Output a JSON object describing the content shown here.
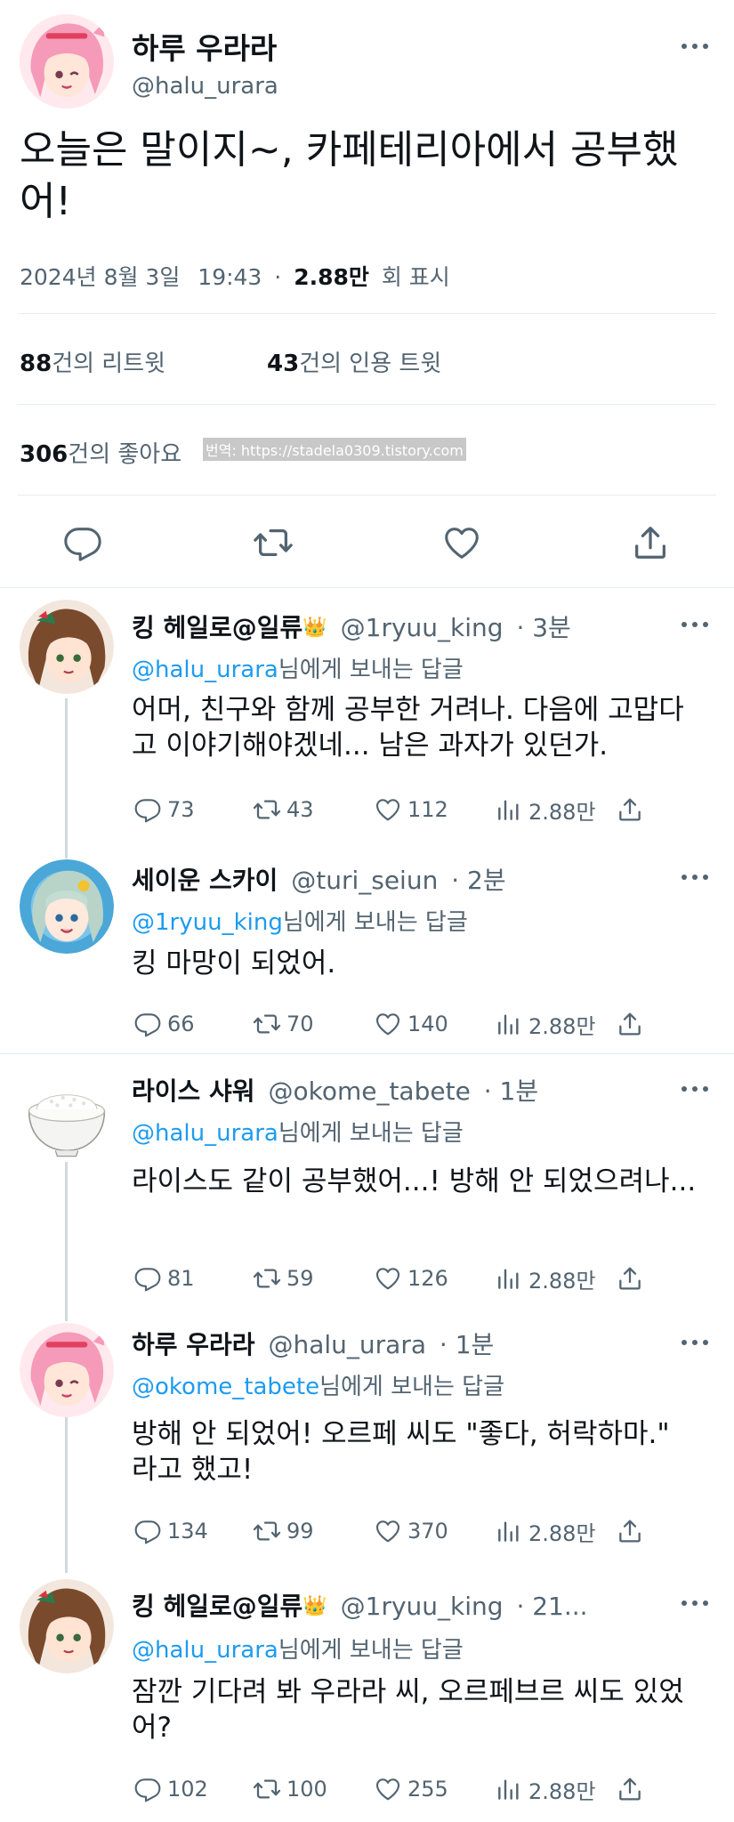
{
  "main_tweet": {
    "author_name": "하루 우라라",
    "author_handle": "@halu_urara",
    "text": "오늘은 말이지~, 카페테리아에서 공부했어!",
    "date": "2024년 8월 3일",
    "time": "19:43",
    "dot": "·",
    "views_count": "2.88만",
    "views_label": "회 표시",
    "retweets_count": "88",
    "retweets_label": "건의 리트윗",
    "quotes_count": "43",
    "quotes_label": "건의 인용 트윗",
    "likes_count": "306",
    "likes_label": "건의 좋아요",
    "watermark": "번역: https://stadela0309.tistory.com"
  },
  "icons": {
    "more": "more-icon",
    "reply": "reply-icon",
    "retweet": "retweet-icon",
    "like": "like-icon",
    "share": "share-icon",
    "views": "views-icon",
    "crown": "crown-icon"
  },
  "colors": {
    "link": "#1d9bf0",
    "secondary": "#536471",
    "text": "#0f1419",
    "divider": "#e6ecf0"
  },
  "replying_to_suffix": "님에게 보내는 답글",
  "replies": [
    {
      "name": "킹 헤일로@일류",
      "badge": "👑",
      "handle": "@1ryuu_king",
      "time": "· 3분",
      "replying_to": "@halu_urara",
      "text": "어머, 친구와 함께 공부한 거려나. 다음에 고맙다고 이야기해야겠네... 남은 과자가 있던가.",
      "replies": "73",
      "retweets": "43",
      "likes": "112",
      "views": "2.88만"
    },
    {
      "name": "세이운 스카이",
      "badge": "",
      "handle": "@turi_seiun",
      "time": "· 2분",
      "replying_to": "@1ryuu_king",
      "text": "킹 마망이 되었어.",
      "replies": "66",
      "retweets": "70",
      "likes": "140",
      "views": "2.88만"
    },
    {
      "name": "라이스 샤워",
      "badge": "",
      "handle": "@okome_tabete",
      "time": "· 1분",
      "replying_to": "@halu_urara",
      "text": "라이스도 같이 공부했어...! 방해 안 되었으려나...",
      "replies": "81",
      "retweets": "59",
      "likes": "126",
      "views": "2.88만"
    },
    {
      "name": "하루 우라라",
      "badge": "",
      "handle": "@halu_urara",
      "time": "· 1분",
      "replying_to": "@okome_tabete",
      "text": "방해 안 되었어! 오르페 씨도 \"좋다, 허락하마.\" 라고 했고!",
      "replies": "134",
      "retweets": "99",
      "likes": "370",
      "views": "2.88만"
    },
    {
      "name": "킹 헤일로@일류",
      "badge": "👑",
      "handle": "@1ryuu_king",
      "time": "· 21...",
      "replying_to": "@halu_urara",
      "text": "잠깐 기다려 봐 우라라 씨, 오르페브르 씨도 있었어?",
      "replies": "102",
      "retweets": "100",
      "likes": "255",
      "views": "2.88만"
    }
  ]
}
